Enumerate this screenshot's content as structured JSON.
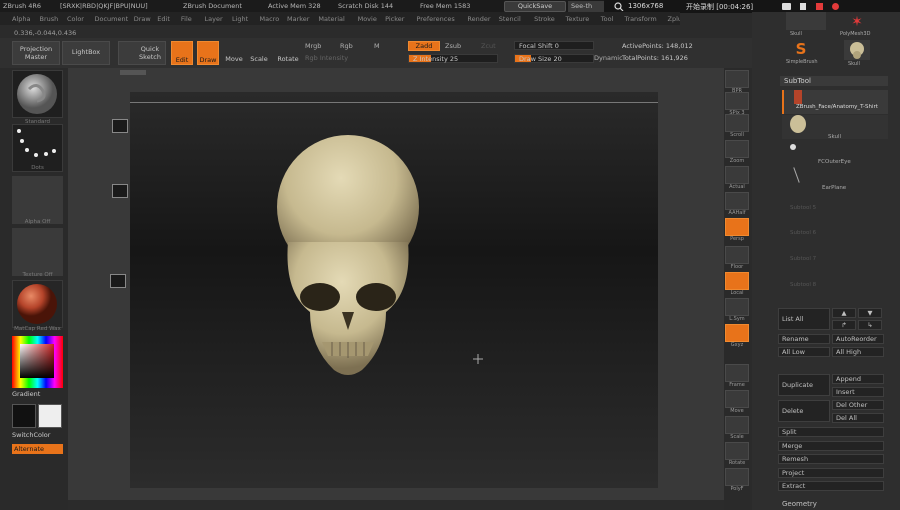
{
  "titlebar": {
    "app": "ZBrush 4R6",
    "segments": [
      "[SRXK|RBD|QKJF|BPU|NUU]",
      "ZBrush Document",
      "Active Mem 328",
      "Scratch Disk 144",
      "Free Mem 1583",
      "QuickSave",
      "See-th"
    ],
    "quicksave": "QuickSave",
    "see_through": "See-th",
    "rec_zoom": "1306x768",
    "rec_status": "开始录制 [00:04:26]"
  },
  "menubar": [
    "Alpha",
    "Brush",
    "Color",
    "Document",
    "Draw",
    "Edit",
    "File",
    "Layer",
    "Light",
    "Macro",
    "Marker",
    "Material",
    "Movie",
    "Picker",
    "Preferences",
    "Render",
    "Stencil",
    "Stroke",
    "Texture",
    "Tool",
    "Transform",
    "Zplugin",
    "Zscript"
  ],
  "coords": "0.336,-0.044,0.436",
  "toolbar": {
    "projection_master": "Projection Master",
    "lightbox": "LightBox",
    "quick_sketch": "Quick Sketch",
    "edit": "Edit",
    "draw": "Draw",
    "move": "Move",
    "scale": "Scale",
    "rotate": "Rotate",
    "mrgb": "Mrgb",
    "rgb": "Rgb",
    "m": "M",
    "rgb_intensity": "Rgb Intensity",
    "zadd": "Zadd",
    "zsub": "Zsub",
    "zcut": "Zcut",
    "z_intensity": "Z Intensity 25",
    "focal_shift": "Focal Shift 0",
    "draw_size": "Draw Size 20",
    "dynamic": "Dynamic",
    "active_points": "ActivePoints: 148,012",
    "total_points": "TotalPoints: 161,926",
    "z_intensity_value": 25,
    "draw_size_value": 20
  },
  "leftshelf": {
    "brush": "Standard",
    "stroke": "Dots",
    "alpha": "Alpha Off",
    "texture": "Texture Off",
    "material": "MatCap Red Wax",
    "gradient": "Gradient",
    "switchcolor": "SwitchColor",
    "alternate": "Alternate"
  },
  "rightshelf": [
    "BPR",
    "SPix 3",
    "Scroll",
    "Zoom",
    "Actual",
    "AAHalf",
    "Persp",
    "Floor",
    "Local",
    "L.Sym",
    "Gxyz",
    "Frame",
    "Move",
    "Scale",
    "Rotate",
    "PolyF"
  ],
  "rpanel": {
    "tools_top": [
      "Skull",
      "PolyMesh3D",
      "SimpleBrush",
      "Skull"
    ],
    "subtool_title": "SubTool",
    "subtools": [
      "ZBrush_Face/Anatomy_T-Shirt",
      "Skull",
      "FCOuterEye",
      "EarPlane"
    ],
    "empty_slots": [
      "Subtool 5",
      "Subtool 6",
      "Subtool 7",
      "Subtool 8"
    ],
    "list_all": "List All",
    "rename": "Rename",
    "autoreorder": "AutoReorder",
    "all_low": "All Low",
    "all_high": "All High",
    "duplicate": "Duplicate",
    "append": "Append",
    "insert": "Insert",
    "delete": "Delete",
    "del_other": "Del Other",
    "del_all": "Del All",
    "split": "Split",
    "merge": "Merge",
    "remesh": "Remesh",
    "project": "Project",
    "extract": "Extract",
    "geometry": "Geometry"
  },
  "colors": {
    "accent": "#e8731a",
    "bg": "#2b2b2b",
    "material": "#b5442a",
    "skull": "#cbbf98"
  }
}
